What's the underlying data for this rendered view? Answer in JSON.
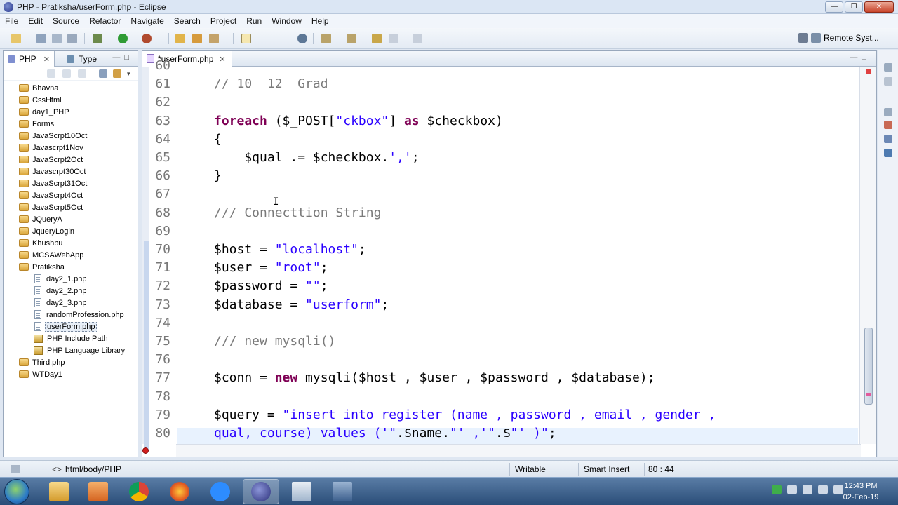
{
  "window": {
    "title": "PHP - Pratiksha/userForm.php - Eclipse"
  },
  "menu": [
    "File",
    "Edit",
    "Source",
    "Refactor",
    "Navigate",
    "Search",
    "Project",
    "Run",
    "Window",
    "Help"
  ],
  "toolbar": {
    "perspective_label": "Remote Syst..."
  },
  "left_panel": {
    "tabs": [
      {
        "label": "PHP"
      },
      {
        "label": "Type"
      }
    ],
    "tree": [
      {
        "label": "Bhavna",
        "kind": "folder",
        "indent": 0
      },
      {
        "label": "CssHtml",
        "kind": "folder",
        "indent": 0
      },
      {
        "label": "day1_PHP",
        "kind": "folder",
        "indent": 0
      },
      {
        "label": "Forms",
        "kind": "folder",
        "indent": 0
      },
      {
        "label": "JavaScrpt10Oct",
        "kind": "folder",
        "indent": 0
      },
      {
        "label": "Javascrpt1Nov",
        "kind": "folder",
        "indent": 0
      },
      {
        "label": "JavaScrpt2Oct",
        "kind": "folder",
        "indent": 0
      },
      {
        "label": "Javascrpt30Oct",
        "kind": "folder",
        "indent": 0
      },
      {
        "label": "JavaScrpt31Oct",
        "kind": "folder",
        "indent": 0
      },
      {
        "label": "JavaScrpt4Oct",
        "kind": "folder",
        "indent": 0
      },
      {
        "label": "JavaScrpt5Oct",
        "kind": "folder",
        "indent": 0
      },
      {
        "label": "JQueryA",
        "kind": "folder",
        "indent": 0
      },
      {
        "label": "JqueryLogin",
        "kind": "folder",
        "indent": 0
      },
      {
        "label": "Khushbu",
        "kind": "folder",
        "indent": 0
      },
      {
        "label": "MCSAWebApp",
        "kind": "folder",
        "indent": 0
      },
      {
        "label": "Pratiksha",
        "kind": "folder",
        "indent": 0
      },
      {
        "label": "day2_1.php",
        "kind": "file",
        "indent": 1
      },
      {
        "label": "day2_2.php",
        "kind": "file",
        "indent": 1
      },
      {
        "label": "day2_3.php",
        "kind": "file",
        "indent": 1
      },
      {
        "label": "randomProfession.php",
        "kind": "file",
        "indent": 1
      },
      {
        "label": "userForm.php",
        "kind": "file",
        "indent": 1,
        "selected": true
      },
      {
        "label": "PHP Include Path",
        "kind": "lib",
        "indent": 1
      },
      {
        "label": "PHP Language Library",
        "kind": "lib",
        "indent": 1
      },
      {
        "label": "Third.php",
        "kind": "folder",
        "indent": 0
      },
      {
        "label": "WTDay1",
        "kind": "folder",
        "indent": 0
      }
    ]
  },
  "editor": {
    "tab_label": "*userForm.php",
    "lines": [
      {
        "n": "60",
        "html": ""
      },
      {
        "n": "61",
        "html": "<span class=\"cm\">// 10  12  Grad</span>"
      },
      {
        "n": "62",
        "html": ""
      },
      {
        "n": "63",
        "html": "<span class=\"kw\">foreach</span> ($_POST[<span class=\"str\">\"ckbox\"</span>] <span class=\"kw\">as</span> $checkbox)"
      },
      {
        "n": "64",
        "html": "{"
      },
      {
        "n": "65",
        "html": "    $qual .= $checkbox.<span class=\"str\">','</span>;"
      },
      {
        "n": "66",
        "html": "}"
      },
      {
        "n": "67",
        "html": ""
      },
      {
        "n": "68",
        "html": "<span class=\"cm\">/// Connecttion String</span>"
      },
      {
        "n": "69",
        "html": ""
      },
      {
        "n": "70",
        "html": "$host = <span class=\"str\">\"localhost\"</span>;"
      },
      {
        "n": "71",
        "html": "$user = <span class=\"str\">\"root\"</span>;"
      },
      {
        "n": "72",
        "html": "$password = <span class=\"str\">\"\"</span>;"
      },
      {
        "n": "73",
        "html": "$database = <span class=\"str\">\"userform\"</span>;"
      },
      {
        "n": "74",
        "html": ""
      },
      {
        "n": "75",
        "html": "<span class=\"cm\">/// new mysqli()</span>"
      },
      {
        "n": "76",
        "html": ""
      },
      {
        "n": "77",
        "html": "$conn = <span class=\"kw\">new</span> mysqli($host , $user , $password , $database);"
      },
      {
        "n": "78",
        "html": ""
      },
      {
        "n": "79",
        "html": "$query = <span class=\"str\">\"insert into register (name , password , email , gender ,</span>"
      },
      {
        "n": "80",
        "html": "<span class=\"str\">qual, course) values ('\"</span>.$name.<span class=\"str\">\"' ,'\"</span>.$<span class=\"str\">\"' )\"</span>;"
      }
    ]
  },
  "statusbar": {
    "breadcrumb": "html/body/PHP",
    "writable": "Writable",
    "insert_mode": "Smart Insert",
    "position": "80 : 44"
  },
  "taskbar": {
    "time": "12:43 PM",
    "date": "02-Feb-19"
  },
  "colors": {
    "keyword": "#7f0055",
    "string": "#2a00ff",
    "comment": "#7a7a7a",
    "current_line": "#e8f2fe"
  }
}
